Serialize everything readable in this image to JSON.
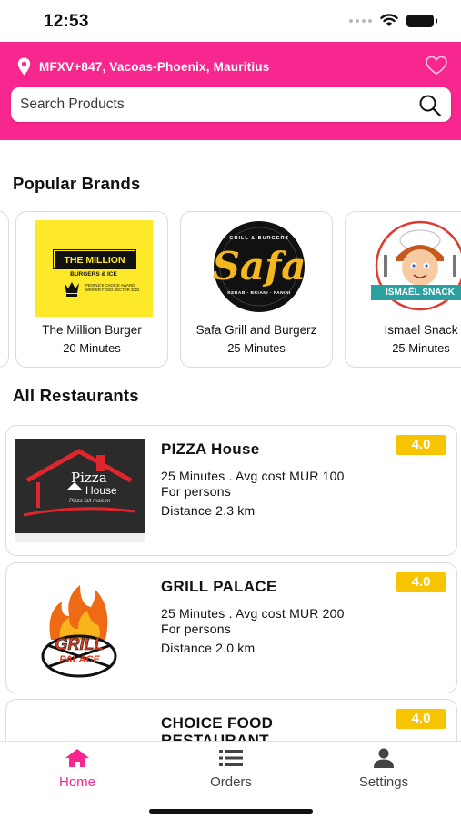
{
  "status_bar": {
    "time": "12:53"
  },
  "header": {
    "location": "MFXV+847, Vacoas-Phoenix, Mauritius",
    "search_placeholder": "Search Products"
  },
  "sections": {
    "popular_brands": "Popular Brands",
    "all_restaurants": "All Restaurants"
  },
  "brands": [
    {
      "name": "The Million Burger",
      "time": "20 Minutes",
      "logo_title": "THE MILLION",
      "logo_subtitle": "BURGERS & ICE",
      "logo_award": "PEOPLE'S CHOICE AWARD WINNER FOOD SECTOR 2022"
    },
    {
      "name": "Safa Grill and Burgerz",
      "time": "25 Minutes",
      "logo_title": "Safa",
      "logo_top": "GRILL & BURGERZ",
      "logo_bottom": "KEBAB · BRIANI · PANINI"
    },
    {
      "name": "Ismael Snack",
      "time": "25 Minutes",
      "logo_banner": "ISMAËL SNACK"
    }
  ],
  "restaurants": [
    {
      "name": "PIZZA House",
      "time_cost": "25 Minutes . Avg cost MUR 100",
      "persons": "For  persons",
      "distance": "Distance 2.3 km",
      "rating": "4.0",
      "logo_line1": "Pizza",
      "logo_line2": "House",
      "logo_tagline": "Pizza fait maison"
    },
    {
      "name": "GRILL PALACE",
      "time_cost": "25 Minutes . Avg cost MUR 200",
      "persons": "For  persons",
      "distance": "Distance 2.0 km",
      "rating": "4.0",
      "logo_line1": "GRILL",
      "logo_line2": "PALACE"
    },
    {
      "name": "CHOICE FOOD RESTAURANT",
      "time_cost": "",
      "persons": "",
      "distance": "",
      "rating": "4.0"
    }
  ],
  "bottom_nav": [
    {
      "label": "Home",
      "icon": "home-icon",
      "active": true
    },
    {
      "label": "Orders",
      "icon": "list-icon",
      "active": false
    },
    {
      "label": "Settings",
      "icon": "user-icon",
      "active": false
    }
  ],
  "colors": {
    "brand_pink": "#f7278f",
    "rating_yellow": "#f6c400",
    "card_border": "#dcdcdc"
  }
}
